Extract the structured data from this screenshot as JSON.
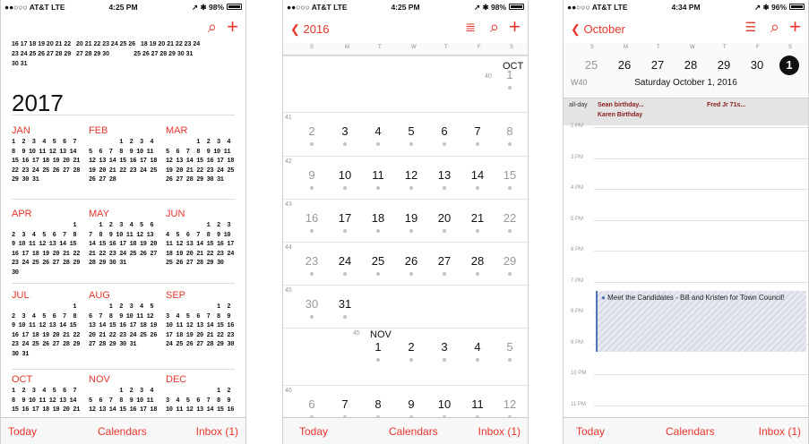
{
  "status": {
    "p1": {
      "carrier": "●●○○○ AT&T  LTE",
      "time": "4:25 PM",
      "battery": "↗ ✱ 98%"
    },
    "p2": {
      "carrier": "●●○○○ AT&T  LTE",
      "time": "4:25 PM",
      "battery": "↗ ✱ 98%"
    },
    "p3": {
      "carrier": "●●○○○ AT&T  LTE",
      "time": "4:34 PM",
      "battery": "↗ ✱ 96%"
    }
  },
  "tabbar": {
    "today": "Today",
    "calendars": "Calendars",
    "inbox": "Inbox (1)"
  },
  "year_view": {
    "prev_rows": [
      "16 17 18 19 20 21 22   20 21 22 23 24 25 26   18 19 20 21 22 23 24",
      "23 24 25 26 27 28 29   27 28 29 30              25 26 27 28 29 30 31",
      "30 31"
    ],
    "year": "2017",
    "months": [
      {
        "name": "JAN",
        "weeks": "1  2  3  4  5  6  7\n8  9 10 11 12 13 14\n15 16 17 18 19 20 21\n22 23 24 25 26 27 28\n29 30 31"
      },
      {
        "name": "FEB",
        "weeks": "         1  2  3  4\n5  6  7  8  9 10 11\n12 13 14 15 16 17 18\n19 20 21 22 23 24 25\n26 27 28"
      },
      {
        "name": "MAR",
        "weeks": "         1  2  3  4\n5  6  7  8  9 10 11\n12 13 14 15 16 17 18\n19 20 21 22 23 24 25\n26 27 28 29 30 31"
      },
      {
        "name": "APR",
        "weeks": "                  1\n2  3  4  5  6  7  8\n9 10 11 12 13 14 15\n16 17 18 19 20 21 22\n23 24 25 26 27 28 29\n30"
      },
      {
        "name": "MAY",
        "weeks": "   1  2  3  4  5  6\n7  8  9 10 11 12 13\n14 15 16 17 18 19 20\n21 22 23 24 25 26 27\n28 29 30 31"
      },
      {
        "name": "JUN",
        "weeks": "            1  2  3\n4  5  6  7  8  9 10\n11 12 13 14 15 16 17\n18 19 20 21 22 23 24\n25 26 27 28 29 30"
      },
      {
        "name": "JUL",
        "weeks": "                  1\n2  3  4  5  6  7  8\n9 10 11 12 13 14 15\n16 17 18 19 20 21 22\n23 24 25 26 27 28 29\n30 31"
      },
      {
        "name": "AUG",
        "weeks": "      1  2  3  4  5\n6  7  8  9 10 11 12\n13 14 15 16 17 18 19\n20 21 22 23 24 25 26\n27 28 29 30 31"
      },
      {
        "name": "SEP",
        "weeks": "               1  2\n3  4  5  6  7  8  9\n10 11 12 13 14 15 16\n17 18 19 20 21 22 23\n24 25 26 27 28 29 30"
      },
      {
        "name": "OCT",
        "weeks": "1  2  3  4  5  6  7\n8  9 10 11 12 13 14\n15 16 17 18 19 20 21"
      },
      {
        "name": "NOV",
        "weeks": "         1  2  3  4\n5  6  7  8  9 10 11\n12 13 14 15 16 17 18"
      },
      {
        "name": "DEC",
        "weeks": "               1  2\n3  4  5  6  7  8  9\n10 11 12 13 14 15 16"
      }
    ]
  },
  "month_view": {
    "back_label": "2016",
    "dow": [
      "S",
      "M",
      "T",
      "W",
      "T",
      "F",
      "S"
    ],
    "oct_label": "OCT",
    "nov_label": "NOV",
    "rows": [
      {
        "wk": "40",
        "days": [
          "",
          "",
          "",
          "",
          "",
          "",
          "1"
        ]
      },
      {
        "wk": "41",
        "days": [
          "2",
          "3",
          "4",
          "5",
          "6",
          "7",
          "8"
        ]
      },
      {
        "wk": "42",
        "days": [
          "9",
          "10",
          "11",
          "12",
          "13",
          "14",
          "15"
        ]
      },
      {
        "wk": "43",
        "days": [
          "16",
          "17",
          "18",
          "19",
          "20",
          "21",
          "22"
        ]
      },
      {
        "wk": "44",
        "days": [
          "23",
          "24",
          "25",
          "26",
          "27",
          "28",
          "29"
        ]
      },
      {
        "wk": "45",
        "days": [
          "30",
          "31",
          "",
          "",
          "",
          "",
          ""
        ]
      },
      {
        "wk": "45",
        "days": [
          "",
          "",
          "1",
          "2",
          "3",
          "4",
          "5"
        ]
      },
      {
        "wk": "46",
        "days": [
          "6",
          "7",
          "8",
          "9",
          "10",
          "11",
          "12"
        ]
      }
    ]
  },
  "day_view": {
    "back_label": "October",
    "dow": [
      "S",
      "M",
      "T",
      "W",
      "T",
      "F",
      "S"
    ],
    "week_days": [
      "25",
      "26",
      "27",
      "28",
      "29",
      "30",
      "1"
    ],
    "week_label": "W40",
    "date_label": "Saturday  October 1, 2016",
    "allday_label": "all-day",
    "allday_events": [
      "Sean        birthday...",
      "Fred Jr            71s...",
      "Karen          Birthday"
    ],
    "hours": [
      "2 PM",
      "3 PM",
      "4 PM",
      "5 PM",
      "6 PM",
      "7 PM",
      "8 PM",
      "9 PM",
      "10 PM",
      "11 PM"
    ],
    "event_text": "Meet the Candidates - Bill and Kristen for Town Council!",
    "accent": "#e8352c"
  }
}
